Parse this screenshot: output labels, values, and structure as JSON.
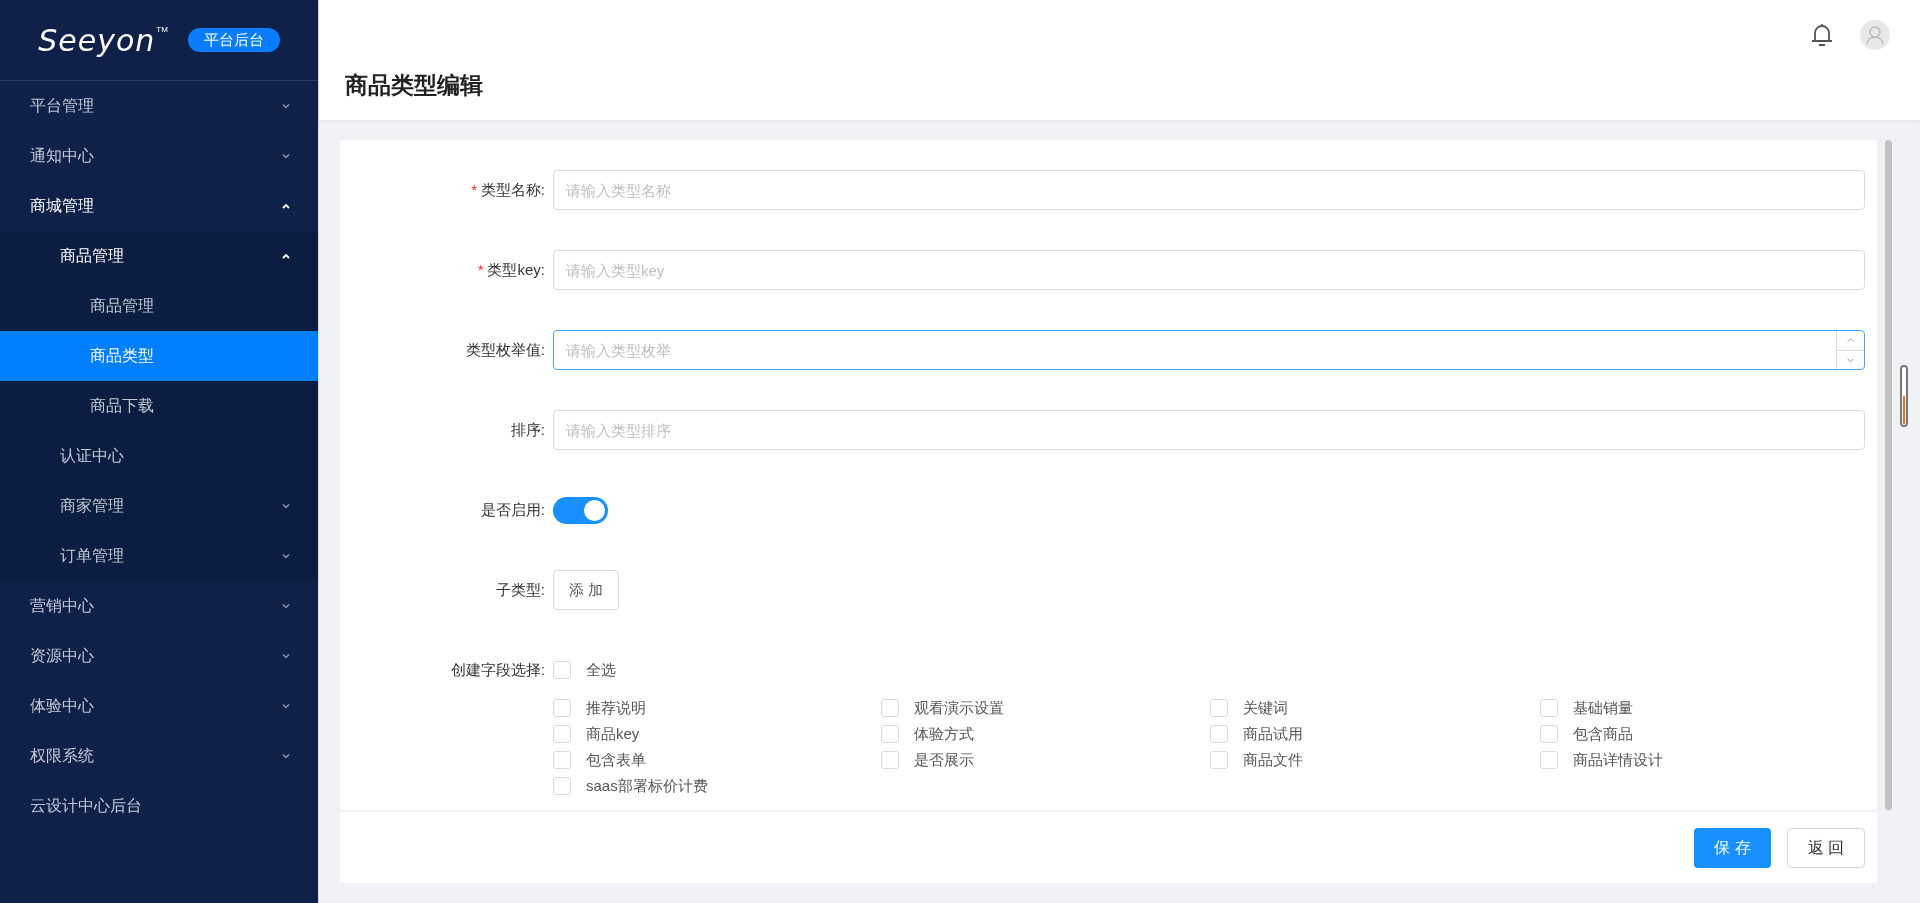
{
  "sidebar": {
    "logo": "Seeyon",
    "logo_mark": "TM",
    "badge": "平台后台",
    "items": [
      {
        "label": "平台管理",
        "expanded": false,
        "selected": false,
        "has_children": true
      },
      {
        "label": "通知中心",
        "expanded": false,
        "selected": false,
        "has_children": true
      },
      {
        "label": "商城管理",
        "expanded": true,
        "selected": false,
        "has_children": true,
        "children": [
          {
            "label": "商品管理",
            "expanded": true,
            "selected": false,
            "has_children": true,
            "children": [
              {
                "label": "商品管理",
                "selected": false
              },
              {
                "label": "商品类型",
                "selected": true
              },
              {
                "label": "商品下载",
                "selected": false
              }
            ]
          },
          {
            "label": "认证中心",
            "expanded": false,
            "selected": false,
            "has_children": false
          },
          {
            "label": "商家管理",
            "expanded": false,
            "selected": false,
            "has_children": true
          },
          {
            "label": "订单管理",
            "expanded": false,
            "selected": false,
            "has_children": true
          }
        ]
      },
      {
        "label": "营销中心",
        "expanded": false,
        "selected": false,
        "has_children": true
      },
      {
        "label": "资源中心",
        "expanded": false,
        "selected": false,
        "has_children": true
      },
      {
        "label": "体验中心",
        "expanded": false,
        "selected": false,
        "has_children": true
      },
      {
        "label": "权限系统",
        "expanded": false,
        "selected": false,
        "has_children": true
      },
      {
        "label": "云设计中心后台",
        "expanded": false,
        "selected": false,
        "has_children": false
      }
    ]
  },
  "header": {
    "title": "商品类型编辑"
  },
  "form": {
    "fields": [
      {
        "kind": "text",
        "label": "类型名称:",
        "required_mark": "*",
        "placeholder": "请输入类型名称",
        "focused": false
      },
      {
        "kind": "text",
        "label": "类型key:",
        "required_mark": "*",
        "placeholder": "请输入类型key",
        "focused": false
      },
      {
        "kind": "number",
        "label": "类型枚举值:",
        "placeholder": "请输入类型枚举",
        "focused": true
      },
      {
        "kind": "text",
        "label": "排序:",
        "placeholder": "请输入类型排序",
        "focused": false
      },
      {
        "kind": "switch",
        "label": "是否启用:",
        "on": true
      },
      {
        "kind": "button",
        "label": "子类型:",
        "button": "添 加"
      }
    ],
    "field_select": {
      "label": "创建字段选择:",
      "select_all": {
        "label": "全选",
        "checked": false
      },
      "options": [
        {
          "label": "推荐说明",
          "checked": false
        },
        {
          "label": "观看演示设置",
          "checked": false
        },
        {
          "label": "关键词",
          "checked": false
        },
        {
          "label": "基础销量",
          "checked": false
        },
        {
          "label": "商品key",
          "checked": false
        },
        {
          "label": "体验方式",
          "checked": false
        },
        {
          "label": "商品试用",
          "checked": false
        },
        {
          "label": "包含商品",
          "checked": false
        },
        {
          "label": "包含表单",
          "checked": false
        },
        {
          "label": "是否展示",
          "checked": false
        },
        {
          "label": "商品文件",
          "checked": false
        },
        {
          "label": "商品详情设计",
          "checked": false
        },
        {
          "label": "saas部署标价计费",
          "checked": false
        }
      ]
    }
  },
  "footer": {
    "buttons": [
      {
        "label": "保 存",
        "kind": "primary"
      },
      {
        "label": "返 回",
        "kind": "default"
      }
    ]
  }
}
